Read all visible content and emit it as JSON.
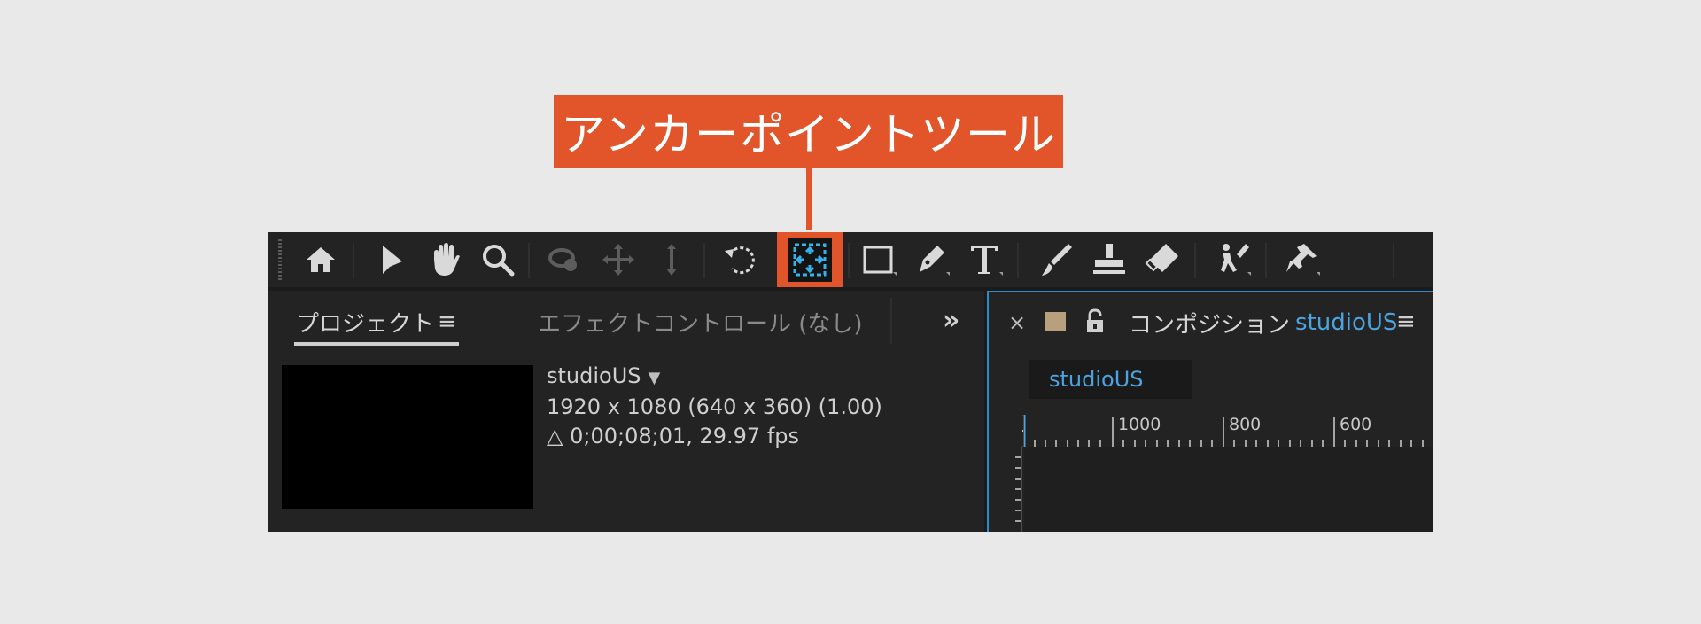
{
  "callout": {
    "label": "アンカーポイントツール"
  },
  "toolbar": {
    "tools": [
      {
        "icon": "home-icon"
      },
      {
        "icon": "selection-arrow-icon"
      },
      {
        "icon": "hand-icon"
      },
      {
        "icon": "zoom-icon"
      },
      {
        "icon": "orbit-camera-icon"
      },
      {
        "icon": "pan-camera-icon"
      },
      {
        "icon": "dolly-camera-icon"
      },
      {
        "icon": "rotate-icon"
      },
      {
        "icon": "anchor-point-icon",
        "active": true
      },
      {
        "icon": "rectangle-icon"
      },
      {
        "icon": "pen-icon"
      },
      {
        "icon": "type-icon"
      },
      {
        "icon": "brush-icon"
      },
      {
        "icon": "clone-stamp-icon"
      },
      {
        "icon": "eraser-icon"
      },
      {
        "icon": "roto-brush-icon"
      },
      {
        "icon": "puppet-pin-icon"
      }
    ]
  },
  "project_panel": {
    "tab_label": "プロジェクト",
    "menu_symbol": "≡",
    "effect_tab_label": "エフェクトコントロール (なし)",
    "overflow_symbol": "»",
    "item_name": "studioUS",
    "caret": "▼",
    "dimensions": "1920 x 1080  (640 x 360) (1.00)",
    "duration": "△ 0;00;08;01, 29.97 fps"
  },
  "comp_panel": {
    "close_symbol": "×",
    "title_prefix": "コンポジション",
    "title_name": "studioUS",
    "menu_symbol": "≡",
    "chip_label": "studioUS",
    "ruler_labels": [
      "1000",
      "800",
      "600"
    ]
  },
  "colors": {
    "accent": "#e2542a",
    "comp_blue": "#4ba3e0",
    "swatch": "#b8a07e"
  }
}
